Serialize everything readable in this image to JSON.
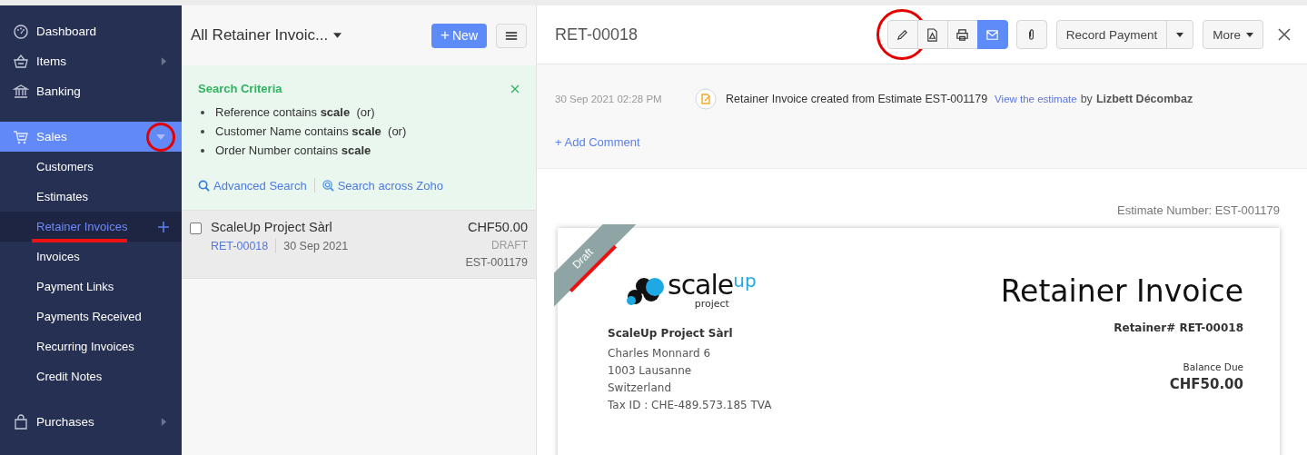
{
  "sidebar": {
    "items": [
      {
        "label": "Dashboard",
        "kind": "dashboard",
        "has_arrow": false,
        "selected": false
      },
      {
        "label": "Items",
        "kind": "basket",
        "has_arrow": true,
        "selected": false
      },
      {
        "label": "Banking",
        "kind": "bank",
        "has_arrow": false,
        "selected": false
      },
      {
        "label": "Sales",
        "kind": "cart",
        "has_arrow": false,
        "selected": true,
        "expanded": true,
        "circled": true,
        "children": [
          {
            "label": "Customers",
            "selected": false,
            "has_add": false,
            "underlined": false
          },
          {
            "label": "Estimates",
            "selected": false,
            "has_add": false,
            "underlined": false
          },
          {
            "label": "Retainer Invoices",
            "selected": true,
            "has_add": true,
            "underlined": true
          },
          {
            "label": "Invoices",
            "selected": false,
            "has_add": false,
            "underlined": false
          },
          {
            "label": "Payment Links",
            "selected": false,
            "has_add": false,
            "underlined": false
          },
          {
            "label": "Payments Received",
            "selected": false,
            "has_add": false,
            "underlined": false
          },
          {
            "label": "Recurring Invoices",
            "selected": false,
            "has_add": false,
            "underlined": false
          },
          {
            "label": "Credit Notes",
            "selected": false,
            "has_add": false,
            "underlined": false
          }
        ]
      },
      {
        "label": "Purchases",
        "kind": "bag",
        "has_arrow": true,
        "selected": false
      }
    ]
  },
  "list": {
    "view_title": "All Retainer Invoic...",
    "new_button": {
      "icon": "+",
      "label": "New"
    },
    "search_criteria": {
      "title": "Search Criteria",
      "criteria": [
        "Reference contains **scale**  (or)",
        "Customer Name contains **scale**  (or)",
        "Order Number contains **scale**"
      ],
      "links": [
        {
          "label": "Advanced Search",
          "kind": "search"
        },
        {
          "label": "Search across Zoho",
          "kind": "zoho-search"
        }
      ]
    },
    "rows": [
      {
        "customer": "ScaleUp Project Sàrl",
        "number": "RET-00018",
        "date": "30 Sep 2021",
        "amount": "CHF50.00",
        "status": "DRAFT",
        "estimate": "EST-001179",
        "checked": false,
        "selected": true
      }
    ]
  },
  "detail": {
    "number": "RET-00018",
    "toolbar": [
      {
        "kind": "edit",
        "active": false,
        "circled": true
      },
      {
        "kind": "pdf",
        "active": false,
        "circled": false
      },
      {
        "kind": "print",
        "active": false,
        "circled": false
      },
      {
        "kind": "email",
        "active": true,
        "circled": false
      }
    ],
    "record_payment": "Record Payment",
    "more": "More",
    "activity": {
      "time": "30 Sep 2021 02:28 PM",
      "text": "Retainer Invoice created from Estimate EST-001179",
      "link": "View the estimate",
      "by": "by",
      "author": "Lizbett Décombaz"
    },
    "add_comment": "+ Add Comment",
    "estimate_number": "Estimate Number: EST-001179",
    "document": {
      "ribbon": "Draft",
      "ribbon_underlined": true,
      "logo": {
        "main": "scale",
        "accent": "up",
        "sub": "project"
      },
      "company": "ScaleUp Project Sàrl",
      "address": [
        "Charles Monnard 6",
        "1003 Lausanne",
        "Switzerland",
        "Tax ID : CHE-489.573.185 TVA"
      ],
      "title": "Retainer Invoice",
      "retainer_number": "Retainer# RET-00018",
      "balance_label": "Balance Due",
      "balance": "CHF50.00"
    }
  }
}
